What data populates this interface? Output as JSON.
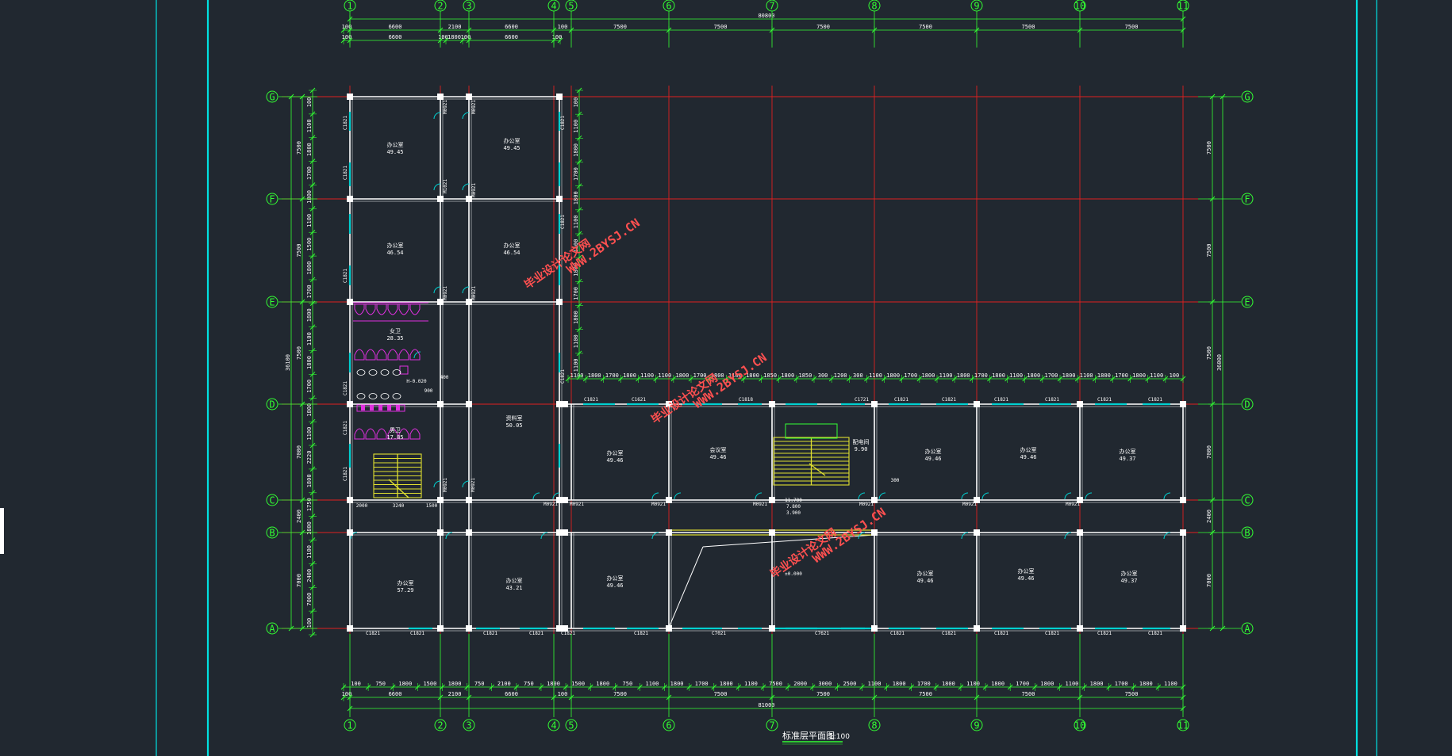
{
  "drawing": {
    "title": "标准层平面图",
    "scale": "1:100"
  },
  "colors": {
    "background": "#212830",
    "grid_axis": "#e02020",
    "wall": "#ffffff",
    "dimension": "#33ff33",
    "window": "#00d0d0",
    "toilet_fixture": "#e030e0",
    "stair": "#e0e030",
    "frame": "#00e0e0",
    "watermark": "#ff5050"
  },
  "axes": {
    "vertical": [
      "1",
      "2",
      "3",
      "4",
      "5",
      "6",
      "7",
      "8",
      "9",
      "10",
      "11"
    ],
    "horizontal": [
      "A",
      "B",
      "C",
      "D",
      "E",
      "F",
      "G"
    ]
  },
  "dimensions": {
    "top_overall": "80800",
    "top_row1": [
      "100",
      "6600",
      "2100",
      "6600",
      "100",
      "7500",
      "7500",
      "7500",
      "7500",
      "7500",
      "7500"
    ],
    "top_row2": [
      "100",
      "6600",
      "100",
      "1800",
      "100",
      "6600",
      "100"
    ],
    "bottom_overall": "81000",
    "bottom_row1": [
      "100",
      "750",
      "1800",
      "1500",
      "1800",
      "750",
      "2100",
      "750",
      "1800",
      "1500",
      "1800",
      "750",
      "1100",
      "1800",
      "1700",
      "1800",
      "1100",
      "7500",
      "2000",
      "3000",
      "2500",
      "1100",
      "1800",
      "1700",
      "1800",
      "1100",
      "1800",
      "1700",
      "1800",
      "1100",
      "1800",
      "1700",
      "1800",
      "1100"
    ],
    "bottom_row2": [
      "100",
      "6600",
      "2100",
      "6600",
      "100",
      "7500",
      "7500",
      "7500",
      "7500",
      "7500",
      "7500"
    ],
    "left_overall": "36100",
    "left_bays": [
      "7500",
      "7500",
      "7500",
      "7000",
      "2400",
      "7000"
    ],
    "left_segments": [
      "100",
      "1100",
      "1800",
      "1700",
      "1800",
      "1100",
      "1500",
      "1800",
      "1700",
      "1800",
      "1100",
      "1800",
      "1700",
      "1800",
      "1100",
      "2220",
      "1800",
      "1750",
      "1800",
      "1100",
      "2400",
      "7000",
      "100"
    ],
    "right_overall": "36000",
    "right_bays": [
      "7500",
      "7500",
      "7500",
      "7000",
      "2400",
      "7000"
    ],
    "mid_chain": [
      "1100",
      "1800",
      "1700",
      "1800",
      "1100",
      "1100",
      "1800",
      "1700",
      "1800",
      "1100",
      "1800",
      "1850",
      "1800",
      "1850",
      "300",
      "1200",
      "300",
      "1100",
      "1800",
      "1700",
      "1800",
      "1100",
      "1800",
      "1700",
      "1800",
      "1100",
      "1800",
      "1700",
      "1800",
      "1100",
      "1800",
      "1700",
      "1800",
      "1100",
      "100"
    ]
  },
  "rooms": [
    {
      "name": "办公室",
      "area": "49.45"
    },
    {
      "name": "办公室",
      "area": "49.45"
    },
    {
      "name": "办公室",
      "area": "46.54"
    },
    {
      "name": "办公室",
      "area": "46.54"
    },
    {
      "name": "女卫",
      "area": "28.35"
    },
    {
      "name": "男卫",
      "area": "17.85"
    },
    {
      "name": "资料室",
      "area": "50.05"
    },
    {
      "name": "办公室",
      "area": "49.46"
    },
    {
      "name": "会议室",
      "area": "49.46"
    },
    {
      "name": "配电间",
      "area": "9.90"
    },
    {
      "name": "办公室",
      "area": "49.46"
    },
    {
      "name": "办公室",
      "area": "49.46"
    },
    {
      "name": "办公室",
      "area": "49.37"
    },
    {
      "name": "办公室",
      "area": "57.29"
    },
    {
      "name": "办公室",
      "area": "43.21"
    },
    {
      "name": "办公室",
      "area": "49.46"
    },
    {
      "name": "办公室",
      "area": "49.46"
    },
    {
      "name": "办公室",
      "area": "49.46"
    },
    {
      "name": "办公室",
      "area": "49.37"
    }
  ],
  "labels": {
    "windows": [
      "C1821",
      "C1821",
      "C1821",
      "C1821",
      "C1821",
      "C1821",
      "C1821",
      "C1821",
      "C1821",
      "C1821",
      "C1621",
      "C1818",
      "C1721",
      "C1821",
      "C1821",
      "C1821",
      "C1821",
      "C1821",
      "C1821",
      "C1821",
      "C1821",
      "C1821",
      "C1821",
      "C1821",
      "C1821",
      "C7021",
      "C7621",
      "C1821",
      "C1821",
      "C1821",
      "C1821",
      "C1821",
      "C1821"
    ],
    "doors": [
      "M0921",
      "M1021",
      "M0921",
      "M0921",
      "M0921",
      "M0921",
      "M0921",
      "M0921",
      "M0921",
      "M0921",
      "M0921",
      "M0921",
      "M0921",
      "M0921",
      "M0921"
    ],
    "levels": [
      "H-0.020",
      "11.700",
      "7.800",
      "3.900",
      "±0.000"
    ],
    "misc": [
      "900",
      "400",
      "300",
      "2000",
      "3240",
      "1500"
    ]
  },
  "watermarks": [
    {
      "cn": "毕业设计论文网",
      "url": "WWW.2BYSJ.CN"
    },
    {
      "cn": "毕业设计论文网",
      "url": "WWW.2BYSJ.CN"
    },
    {
      "cn": "毕业设计论文网",
      "url": "WWW.2BYSJ.CN"
    }
  ]
}
